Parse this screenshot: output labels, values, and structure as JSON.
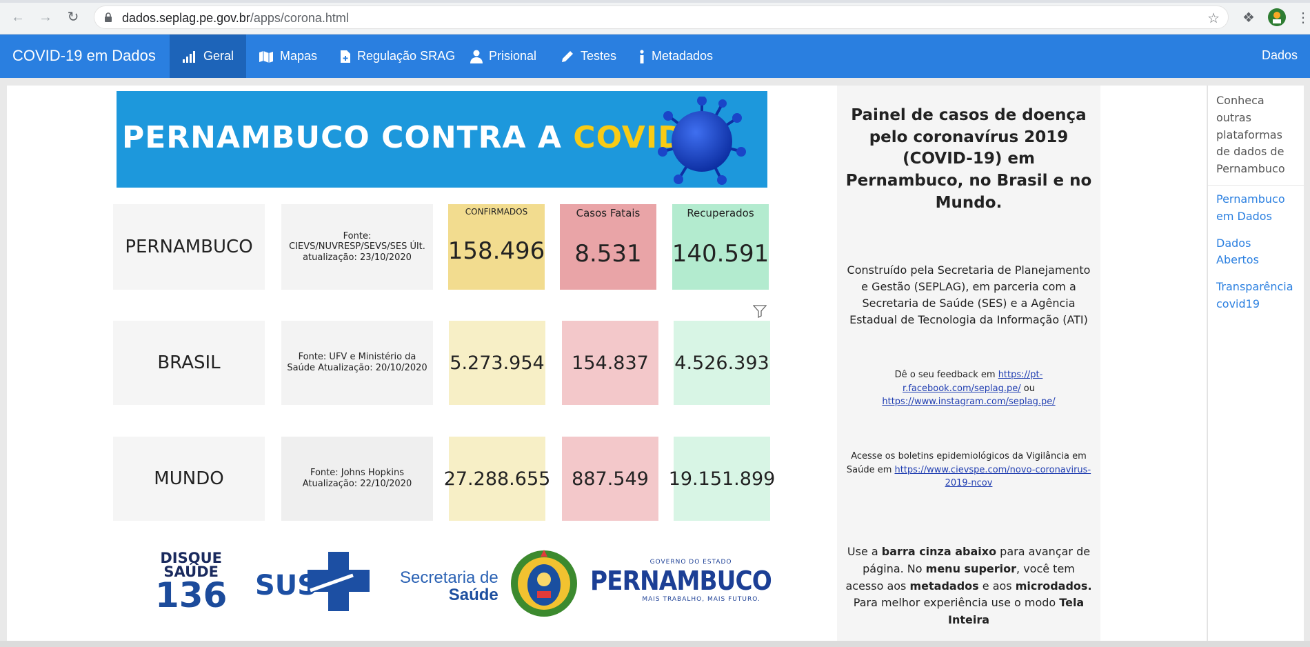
{
  "browser": {
    "url_domain": "dados.seplag.pe.gov.br",
    "url_path": "/apps/corona.html"
  },
  "navbar": {
    "brand": "COVID-19 em Dados",
    "items": [
      {
        "label": "Geral",
        "icon": "bar-chart-icon",
        "active": true
      },
      {
        "label": "Mapas",
        "icon": "map-icon"
      },
      {
        "label": "Regulação SRAG",
        "icon": "document-plus-icon"
      },
      {
        "label": "Prisional",
        "icon": "user-icon"
      },
      {
        "label": "Testes",
        "icon": "pencil-icon"
      },
      {
        "label": "Metadados",
        "icon": "info-icon"
      }
    ],
    "right_label": "Dados"
  },
  "banner": {
    "text_a": "PERNAMBUCO CONTRA A ",
    "text_b": "COVID19"
  },
  "stats": [
    {
      "region": "PERNAMBUCO",
      "source": "Fonte: CIEVS/NUVRESP/SEVS/SES Últ. atualização: 23/10/2020",
      "confirmed_label": "CONFIRMADOS",
      "fatal_label": "Casos Fatais",
      "recovered_label": "Recuperados",
      "confirmed": "158.496",
      "fatal": "8.531",
      "recovered": "140.591"
    },
    {
      "region": "BRASIL",
      "source": "Fonte: UFV e Ministério da Saúde Atualização: 20/10/2020",
      "confirmed": "5.273.954",
      "fatal": "154.837",
      "recovered": "4.526.393"
    },
    {
      "region": "MUNDO",
      "source": "Fonte: Johns Hopkins Atualização: 22/10/2020",
      "confirmed": "27.288.655",
      "fatal": "887.549",
      "recovered": "19.151.899"
    }
  ],
  "logos": {
    "disque_l1": "DISQUE",
    "disque_l2": "SAÚDE",
    "disque_l3": "136",
    "sus": "SUS",
    "sec_a": "Secretaria de",
    "sec_b": "Saúde",
    "pe_gov": "GOVERNO DO ESTADO",
    "pe_name": "PERNAMBUCO",
    "pe_slogan": "MAIS TRABALHO, MAIS FUTURO."
  },
  "info": {
    "title": "Painel de casos de doença pelo coronavírus 2019 (COVID-19) em Pernambuco, no Brasil e no Mundo.",
    "built_by": "Construído pela Secretaria de Planejamento e Gestão (SEPLAG), em parceria com a Secretaria de Saúde (SES) e a Agência Estadual de Tecnologia da Informação (ATI)",
    "feedback_prefix": "Dê o seu feedback em ",
    "feedback_link1": "https://pt-r.facebook.com/seplag.pe/",
    "feedback_mid": " ou ",
    "feedback_link2": "https://www.instagram.com/seplag.pe/",
    "bulletin_prefix": "Acesse os boletins epidemiológicos da Vigilância em Saúde em ",
    "bulletin_link": "https://www.cievspe.com/novo-coronavirus-2019-ncov",
    "usage_a": "Use a ",
    "usage_b": "barra cinza abaixo",
    "usage_c": " para avançar de página.  No ",
    "usage_d": "menu superior",
    "usage_e": ", você tem acesso aos ",
    "usage_f": "metadados",
    "usage_g": " e aos ",
    "usage_h": "microdados.",
    "usage_i": " Para melhor experiência use o modo ",
    "usage_j": "Tela Inteira"
  },
  "sidebar": {
    "intro": "Conheca outras plataformas de dados de Pernambuco",
    "links": [
      "Pernambuco em Dados",
      "Dados Abertos",
      "Transparência covid19"
    ]
  },
  "colors": {
    "navbar": "#2a7fe0",
    "navbar_active": "#1d64b9",
    "confirmed": "#f2dc8f",
    "fatal": "#e9a4a7",
    "recovered": "#b3ebcf"
  }
}
